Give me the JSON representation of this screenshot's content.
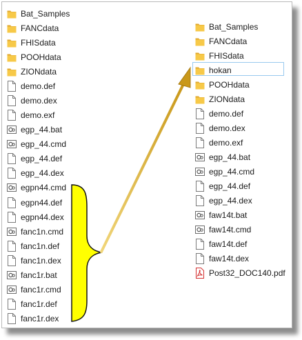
{
  "left_pane": {
    "items": [
      {
        "label": "Bat_Samples",
        "icon": "folder-icon"
      },
      {
        "label": "FANCdata",
        "icon": "folder-icon"
      },
      {
        "label": "FHISdata",
        "icon": "folder-icon"
      },
      {
        "label": "POOHdata",
        "icon": "folder-icon"
      },
      {
        "label": "ZIONdata",
        "icon": "folder-icon"
      },
      {
        "label": "demo.def",
        "icon": "file-icon"
      },
      {
        "label": "demo.dex",
        "icon": "file-icon"
      },
      {
        "label": "demo.exf",
        "icon": "file-icon"
      },
      {
        "label": "egp_44.bat",
        "icon": "gear-file-icon"
      },
      {
        "label": "egp_44.cmd",
        "icon": "gear-file-icon"
      },
      {
        "label": "egp_44.def",
        "icon": "file-icon"
      },
      {
        "label": "egp_44.dex",
        "icon": "file-icon"
      },
      {
        "label": "egpn44.cmd",
        "icon": "gear-file-icon"
      },
      {
        "label": "egpn44.def",
        "icon": "file-icon"
      },
      {
        "label": "egpn44.dex",
        "icon": "file-icon"
      },
      {
        "label": "fanc1n.cmd",
        "icon": "gear-file-icon"
      },
      {
        "label": "fanc1n.def",
        "icon": "file-icon"
      },
      {
        "label": "fanc1n.dex",
        "icon": "file-icon"
      },
      {
        "label": "fanc1r.bat",
        "icon": "gear-file-icon"
      },
      {
        "label": "fanc1r.cmd",
        "icon": "gear-file-icon"
      },
      {
        "label": "fanc1r.def",
        "icon": "file-icon"
      },
      {
        "label": "fanc1r.dex",
        "icon": "file-icon"
      }
    ]
  },
  "right_pane": {
    "selected_index": 3,
    "items": [
      {
        "label": "Bat_Samples",
        "icon": "folder-icon"
      },
      {
        "label": "FANCdata",
        "icon": "folder-icon"
      },
      {
        "label": "FHISdata",
        "icon": "folder-icon"
      },
      {
        "label": "hokan",
        "icon": "folder-icon"
      },
      {
        "label": "POOHdata",
        "icon": "folder-icon"
      },
      {
        "label": "ZIONdata",
        "icon": "folder-icon"
      },
      {
        "label": "demo.def",
        "icon": "file-icon"
      },
      {
        "label": "demo.dex",
        "icon": "file-icon"
      },
      {
        "label": "demo.exf",
        "icon": "file-icon"
      },
      {
        "label": "egp_44.bat",
        "icon": "gear-file-icon"
      },
      {
        "label": "egp_44.cmd",
        "icon": "gear-file-icon"
      },
      {
        "label": "egp_44.def",
        "icon": "file-icon"
      },
      {
        "label": "egp_44.dex",
        "icon": "file-icon"
      },
      {
        "label": "faw14t.bat",
        "icon": "gear-file-icon"
      },
      {
        "label": "faw14t.cmd",
        "icon": "gear-file-icon"
      },
      {
        "label": "faw14t.def",
        "icon": "file-icon"
      },
      {
        "label": "faw14t.dex",
        "icon": "file-icon"
      },
      {
        "label": "Post32_DOC140.pdf",
        "icon": "pdf-icon"
      }
    ]
  },
  "colors": {
    "folder": "#f7c948",
    "folder_dark": "#e0a82e",
    "bracket_fill": "#ffff00",
    "arrow": "#d4a017",
    "selection_border": "#99c9ef",
    "pdf_red": "#d32f2f"
  }
}
